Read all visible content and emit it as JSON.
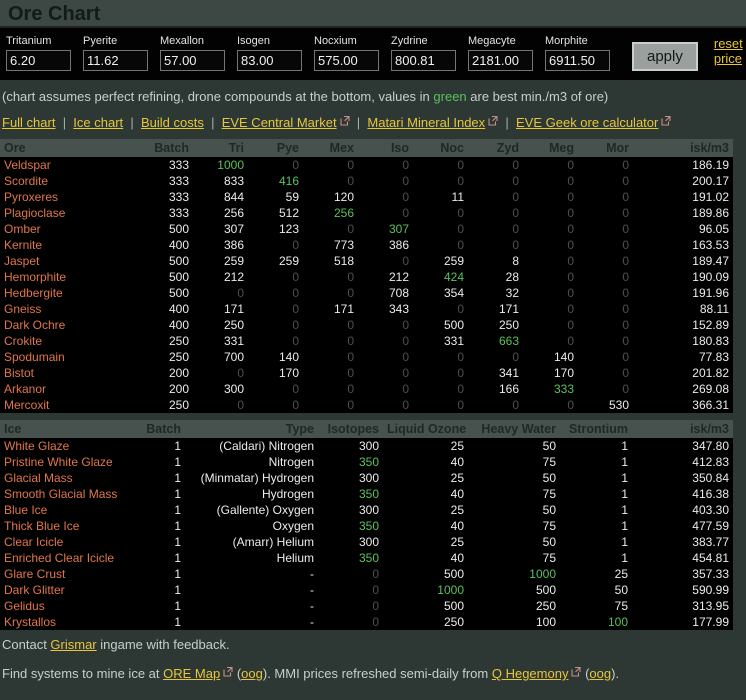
{
  "title_bar": {
    "title": "Ore Chart"
  },
  "price_form": {
    "fields": [
      {
        "label": "Tritanium",
        "value": "6.20"
      },
      {
        "label": "Pyerite",
        "value": "11.62"
      },
      {
        "label": "Mexallon",
        "value": "57.00"
      },
      {
        "label": "Isogen",
        "value": "83.00"
      },
      {
        "label": "Nocxium",
        "value": "575.00"
      },
      {
        "label": "Zydrine",
        "value": "800.81"
      },
      {
        "label": "Megacyte",
        "value": "2181.00"
      },
      {
        "label": "Morphite",
        "value": "6911.50"
      }
    ],
    "apply_label": "apply",
    "reset_label": "reset price"
  },
  "note": {
    "before": "(chart assumes perfect refining, drone compounds at the bottom, values in ",
    "highlight": "green",
    "after": " are best min./m3 of ore)"
  },
  "nav_links": [
    {
      "label": "Full chart",
      "external": false
    },
    {
      "label": "Ice chart",
      "external": false
    },
    {
      "label": "Build costs",
      "external": false
    },
    {
      "label": "EVE Central Market",
      "external": true
    },
    {
      "label": "Matari Mineral Index",
      "external": true
    },
    {
      "label": "EVE Geek ore calculator",
      "external": true
    }
  ],
  "ore_table": {
    "headers": [
      "Ore",
      "Batch",
      "Tri",
      "Pye",
      "Mex",
      "Iso",
      "Noc",
      "Zyd",
      "Meg",
      "Mor",
      "isk/m3"
    ],
    "rows": [
      {
        "name": "Veldspar",
        "cells": [
          "333",
          "1000",
          "0",
          "0",
          "0",
          "0",
          "0",
          "0",
          "0",
          "186.19"
        ],
        "green": [
          1
        ]
      },
      {
        "name": "Scordite",
        "cells": [
          "333",
          "833",
          "416",
          "0",
          "0",
          "0",
          "0",
          "0",
          "0",
          "200.17"
        ],
        "green": [
          2
        ]
      },
      {
        "name": "Pyroxeres",
        "cells": [
          "333",
          "844",
          "59",
          "120",
          "0",
          "11",
          "0",
          "0",
          "0",
          "191.02"
        ],
        "green": []
      },
      {
        "name": "Plagioclase",
        "cells": [
          "333",
          "256",
          "512",
          "256",
          "0",
          "0",
          "0",
          "0",
          "0",
          "189.86"
        ],
        "green": [
          3
        ]
      },
      {
        "name": "Omber",
        "cells": [
          "500",
          "307",
          "123",
          "0",
          "307",
          "0",
          "0",
          "0",
          "0",
          "96.05"
        ],
        "green": [
          4
        ]
      },
      {
        "name": "Kernite",
        "cells": [
          "400",
          "386",
          "0",
          "773",
          "386",
          "0",
          "0",
          "0",
          "0",
          "163.53"
        ],
        "green": []
      },
      {
        "name": "Jaspet",
        "cells": [
          "500",
          "259",
          "259",
          "518",
          "0",
          "259",
          "8",
          "0",
          "0",
          "189.47"
        ],
        "green": []
      },
      {
        "name": "Hemorphite",
        "cells": [
          "500",
          "212",
          "0",
          "0",
          "212",
          "424",
          "28",
          "0",
          "0",
          "190.09"
        ],
        "green": [
          5
        ]
      },
      {
        "name": "Hedbergite",
        "cells": [
          "500",
          "0",
          "0",
          "0",
          "708",
          "354",
          "32",
          "0",
          "0",
          "191.96"
        ],
        "green": []
      },
      {
        "name": "Gneiss",
        "cells": [
          "400",
          "171",
          "0",
          "171",
          "343",
          "0",
          "171",
          "0",
          "0",
          "88.11"
        ],
        "green": []
      },
      {
        "name": "Dark Ochre",
        "cells": [
          "400",
          "250",
          "0",
          "0",
          "0",
          "500",
          "250",
          "0",
          "0",
          "152.89"
        ],
        "green": []
      },
      {
        "name": "Crokite",
        "cells": [
          "250",
          "331",
          "0",
          "0",
          "0",
          "331",
          "663",
          "0",
          "0",
          "180.83"
        ],
        "green": [
          6
        ]
      },
      {
        "name": "Spodumain",
        "cells": [
          "250",
          "700",
          "140",
          "0",
          "0",
          "0",
          "0",
          "140",
          "0",
          "77.83"
        ],
        "green": []
      },
      {
        "name": "Bistot",
        "cells": [
          "200",
          "0",
          "170",
          "0",
          "0",
          "0",
          "341",
          "170",
          "0",
          "201.82"
        ],
        "green": []
      },
      {
        "name": "Arkanor",
        "cells": [
          "200",
          "300",
          "0",
          "0",
          "0",
          "0",
          "166",
          "333",
          "0",
          "269.08"
        ],
        "green": [
          7
        ]
      },
      {
        "name": "Mercoxit",
        "cells": [
          "250",
          "0",
          "0",
          "0",
          "0",
          "0",
          "0",
          "0",
          "530",
          "366.31"
        ],
        "green": []
      }
    ]
  },
  "ice_table": {
    "headers": [
      "Ice",
      "Batch",
      "Type",
      "Isotopes",
      "Liquid Ozone",
      "Heavy Water",
      "Strontium",
      "isk/m3"
    ],
    "rows": [
      {
        "name": "White Glaze",
        "cells": [
          "1",
          "(Caldari) Nitrogen",
          "300",
          "25",
          "50",
          "1",
          "347.80"
        ],
        "green": []
      },
      {
        "name": "Pristine White Glaze",
        "cells": [
          "1",
          "Nitrogen",
          "350",
          "40",
          "75",
          "1",
          "412.83"
        ],
        "green": [
          2
        ]
      },
      {
        "name": "Glacial Mass",
        "cells": [
          "1",
          "(Minmatar) Hydrogen",
          "300",
          "25",
          "50",
          "1",
          "350.84"
        ],
        "green": []
      },
      {
        "name": "Smooth Glacial Mass",
        "cells": [
          "1",
          "Hydrogen",
          "350",
          "40",
          "75",
          "1",
          "416.38"
        ],
        "green": [
          2
        ]
      },
      {
        "name": "Blue Ice",
        "cells": [
          "1",
          "(Gallente) Oxygen",
          "300",
          "25",
          "50",
          "1",
          "403.30"
        ],
        "green": []
      },
      {
        "name": "Thick Blue Ice",
        "cells": [
          "1",
          "Oxygen",
          "350",
          "40",
          "75",
          "1",
          "477.59"
        ],
        "green": [
          2
        ]
      },
      {
        "name": "Clear Icicle",
        "cells": [
          "1",
          "(Amarr) Helium",
          "300",
          "25",
          "50",
          "1",
          "383.77"
        ],
        "green": []
      },
      {
        "name": "Enriched Clear Icicle",
        "cells": [
          "1",
          "Helium",
          "350",
          "40",
          "75",
          "1",
          "454.81"
        ],
        "green": [
          2
        ]
      },
      {
        "name": "Glare Crust",
        "cells": [
          "1",
          "-",
          "0",
          "500",
          "1000",
          "25",
          "357.33"
        ],
        "green": [
          4
        ]
      },
      {
        "name": "Dark Glitter",
        "cells": [
          "1",
          "-",
          "0",
          "1000",
          "500",
          "50",
          "590.99"
        ],
        "green": [
          3
        ]
      },
      {
        "name": "Gelidus",
        "cells": [
          "1",
          "-",
          "0",
          "500",
          "250",
          "75",
          "313.95"
        ],
        "green": []
      },
      {
        "name": "Krystallos",
        "cells": [
          "1",
          "-",
          "0",
          "250",
          "100",
          "100",
          "177.99"
        ],
        "green": [
          5
        ]
      }
    ]
  },
  "footer": {
    "line1": {
      "before": "Contact ",
      "link": "Grismar",
      "after": " ingame with feedback."
    },
    "line2": {
      "part1": "Find systems to mine ice at ",
      "link1": "ORE Map",
      "part2": " (",
      "link2": "oog",
      "part3": "). MMI prices refreshed semi-daily from ",
      "link3": "Q Hegemony",
      "part4": " (",
      "link4": "oog",
      "part5": ")."
    }
  },
  "colors": {
    "link_yellow": "#e7c63b",
    "highlight_green": "#5cc05c",
    "ore_name_orange": "#e0764a",
    "dim_zero_gray": "#4f4f4f",
    "table_header_bg": "#47514d",
    "page_bg": "#2d3835"
  }
}
